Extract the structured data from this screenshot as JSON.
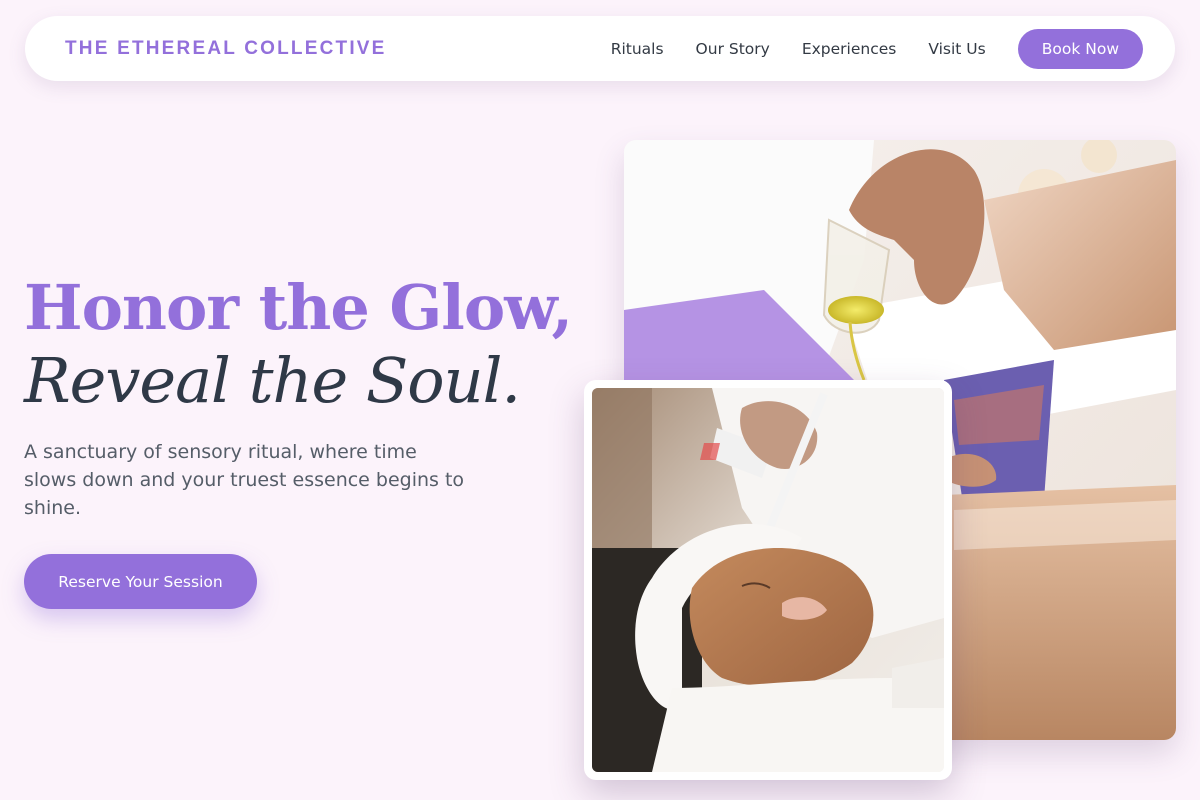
{
  "nav": {
    "brand": "THE ETHEREAL COLLECTIVE",
    "links": [
      "Rituals",
      "Our Story",
      "Experiences",
      "Visit Us"
    ],
    "cta": "Book Now"
  },
  "hero": {
    "headline_line1": "Honor the Glow,",
    "headline_line2": "Reveal the Soul.",
    "subtext": "A sanctuary of sensory ritual, where time slows down and your truest essence begins to shine.",
    "cta": "Reserve Your Session"
  },
  "images": {
    "large": "massage-oil-photo",
    "small": "facial-mask-photo"
  },
  "colors": {
    "accent": "#9370db",
    "background": "#fcf3fb",
    "heading_dark": "#2f3947",
    "body_text": "#555d68"
  }
}
